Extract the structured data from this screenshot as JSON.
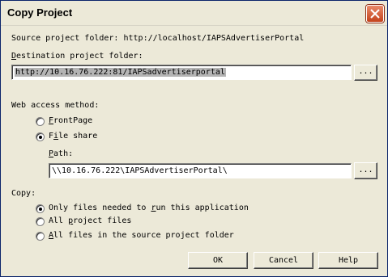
{
  "window": {
    "title": "Copy Project"
  },
  "source": {
    "label": "Source project folder:",
    "value": "http://localhost/IAPSAdvertiserPortal"
  },
  "destination": {
    "label_prefix": "",
    "label_underline": "D",
    "label_rest": "estination project folder:",
    "value": "http://10.16.76.222:81/IAPSadvertiserportal",
    "browse_label": "..."
  },
  "web_access": {
    "label": "Web access method:",
    "options": [
      {
        "u": "F",
        "rest": "rontPage",
        "selected": false
      },
      {
        "pre": "F",
        "u": "i",
        "rest": "le share",
        "selected": true
      }
    ]
  },
  "path": {
    "label_u": "P",
    "label_rest": "ath:",
    "value": "\\\\10.16.76.222\\IAPSAdvertiserPortal\\",
    "browse_label": "..."
  },
  "copy": {
    "label": "Copy:",
    "options": [
      {
        "pre": "Only files needed to ",
        "u": "r",
        "rest": "un this application",
        "selected": true
      },
      {
        "pre": "All ",
        "u": "p",
        "rest": "roject files",
        "selected": false
      },
      {
        "pre": "",
        "u": "A",
        "rest": "ll files in the source project folder",
        "selected": false
      }
    ]
  },
  "buttons": {
    "ok": "OK",
    "cancel": "Cancel",
    "help": "Help"
  }
}
